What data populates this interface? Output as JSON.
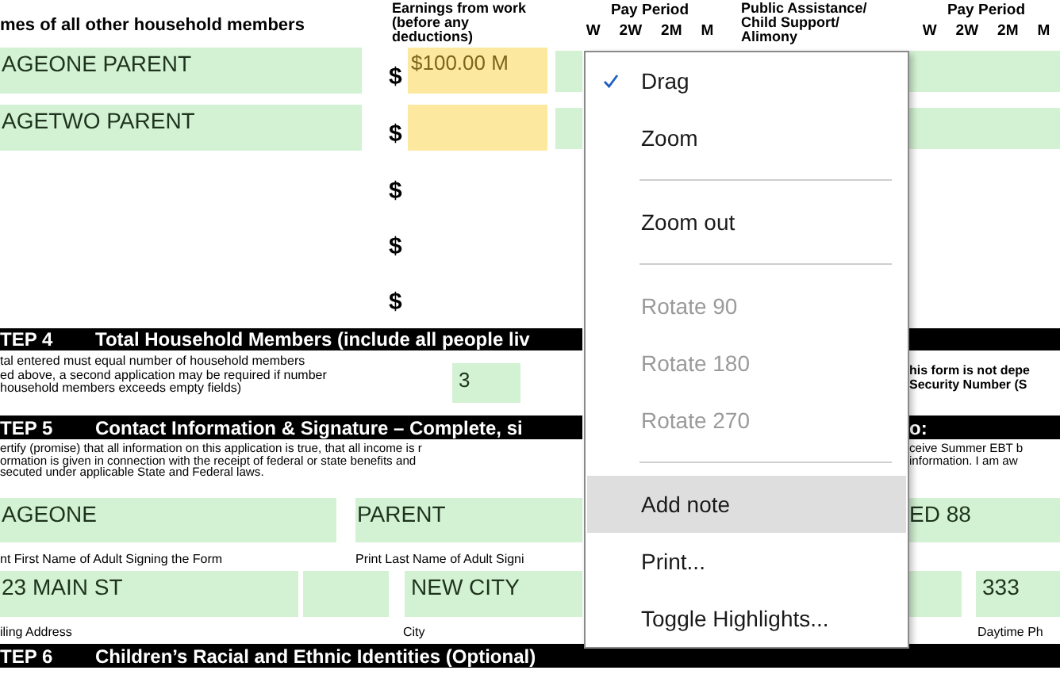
{
  "form": {
    "header": {
      "names_heading": "mes of all other household members",
      "earnings_heading": "Earnings from work\n(before any\ndeductions)",
      "assistance_heading": "Public Assistance/\nChild Support/\nAlimony",
      "pay_periods": [
        {
          "title": "Pay Period",
          "options": [
            "W",
            "2W",
            "2M",
            "M"
          ]
        },
        {
          "title": "Pay Period",
          "options": [
            "W",
            "2W",
            "2M",
            "M"
          ]
        }
      ]
    },
    "members": [
      {
        "kind": "fields",
        "name": "AGEONE PARENT",
        "currency": "$",
        "earnings": "$100.00 M"
      },
      {
        "kind": "fields",
        "name": "AGETWO PARENT",
        "currency": "$"
      },
      {
        "kind": "blank",
        "currency": "$"
      },
      {
        "kind": "blank",
        "currency": "$"
      },
      {
        "kind": "blank",
        "currency": "$"
      }
    ],
    "step4": {
      "label": "TEP 4",
      "title": "Total Household Members (include all people liv",
      "note": "tal entered must equal number of household members\ned above, a second application may be required if number\nhousehold members exceeds empty fields)",
      "total": "3",
      "side_note": "his form is not depe\nSecurity Number (S"
    },
    "step5": {
      "label": "TEP 5",
      "title": "Contact Information & Signature – Complete, si",
      "side_title": "o:",
      "statement": "ertify (promise) that all information on this application is true, that all income is r\normation is given in connection with the receipt of federal or state benefits and\nsecuted under applicable State and Federal laws.",
      "side_statement": "ceive Summer EBT b\ninformation. I am aw",
      "first_name": "AGEONE",
      "first_name_label": "nt First Name of Adult Signing the Form",
      "last_name": "PARENT",
      "last_name_label": "Print Last Name of Adult Signi",
      "side_field": "ED 88",
      "address": "23 MAIN ST",
      "address_label": "iling Address",
      "city": "NEW CITY",
      "city_label": "City",
      "phone": "333",
      "phone_label": "Daytime Ph"
    },
    "step6": {
      "label": "TEP 6",
      "title": "Children’s Racial and Ethnic Identities (Optional)"
    }
  },
  "context_menu": [
    {
      "kind": "item",
      "label": "Drag",
      "checked": true,
      "disabled": false,
      "selected": false
    },
    {
      "kind": "item",
      "label": "Zoom",
      "checked": false,
      "disabled": false,
      "selected": false
    },
    {
      "kind": "separator"
    },
    {
      "kind": "item",
      "label": "Zoom out",
      "checked": false,
      "disabled": false,
      "selected": false
    },
    {
      "kind": "separator"
    },
    {
      "kind": "item",
      "label": "Rotate 90",
      "checked": false,
      "disabled": true,
      "selected": false
    },
    {
      "kind": "item",
      "label": "Rotate 180",
      "checked": false,
      "disabled": true,
      "selected": false
    },
    {
      "kind": "item",
      "label": "Rotate 270",
      "checked": false,
      "disabled": true,
      "selected": false
    },
    {
      "kind": "separator"
    },
    {
      "kind": "item",
      "label": "Add note",
      "checked": false,
      "disabled": false,
      "selected": true
    },
    {
      "kind": "item",
      "label": "Print...",
      "checked": false,
      "disabled": false,
      "selected": false
    },
    {
      "kind": "item",
      "label": "Toggle Highlights...",
      "checked": false,
      "disabled": false,
      "selected": false
    }
  ]
}
